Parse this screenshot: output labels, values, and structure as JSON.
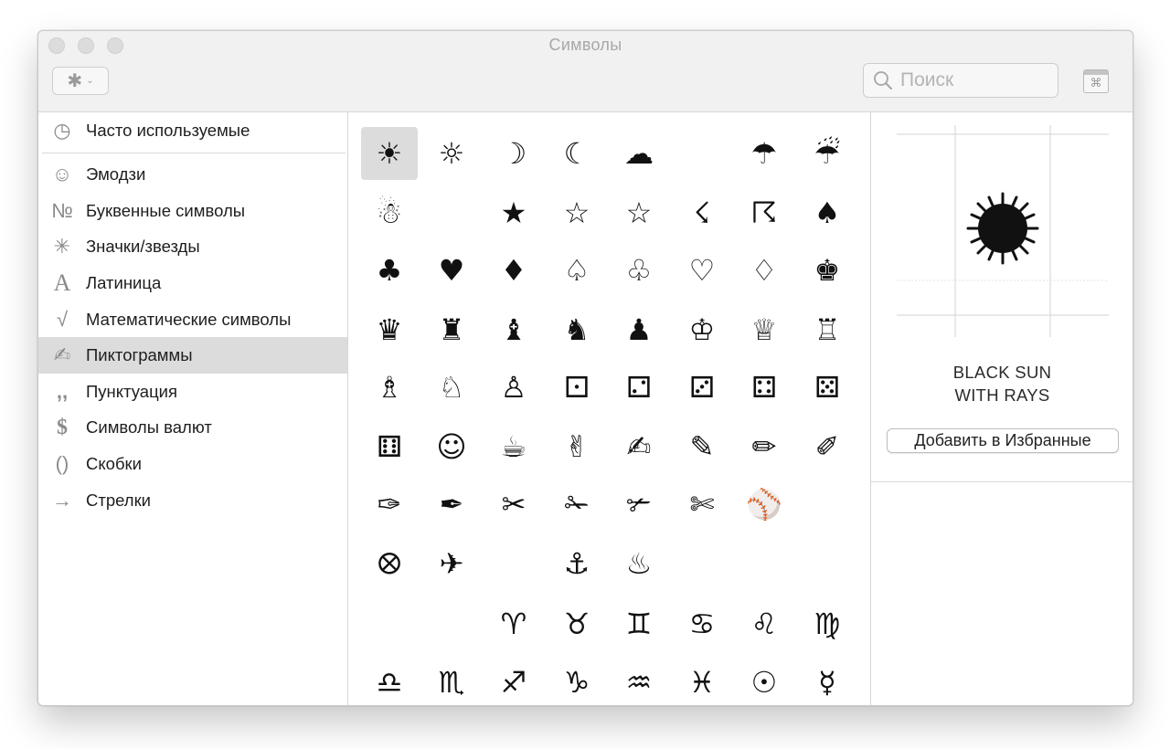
{
  "window": {
    "title": "Символы"
  },
  "toolbar": {
    "gear_icon": "✱",
    "chevron": "⌄",
    "search_placeholder": "Поиск",
    "viewer_icon": "⌘"
  },
  "sidebar": {
    "items": [
      {
        "icon": "◷",
        "label": "Часто используемые"
      },
      {
        "icon": "☺",
        "label": "Эмодзи"
      },
      {
        "icon": "№",
        "label": "Буквенные символы"
      },
      {
        "icon": "✳",
        "label": "Значки/звезды"
      },
      {
        "icon": "A",
        "label": "Латиница"
      },
      {
        "icon": "√",
        "label": "Математические символы"
      },
      {
        "icon": "✍",
        "label": "Пиктограммы"
      },
      {
        "icon": ",,",
        "label": "Пунктуация"
      },
      {
        "icon": "$",
        "label": "Символы валют"
      },
      {
        "icon": "()",
        "label": "Скобки"
      },
      {
        "icon": "→",
        "label": "Стрелки"
      }
    ],
    "selected": "Пиктограммы"
  },
  "grid": {
    "rows": [
      [
        "☀",
        "☼",
        "☽",
        "☾",
        "☁",
        "",
        "☂",
        "☔"
      ],
      [
        "☃",
        "",
        "★",
        "☆",
        "☆",
        "☇",
        "☈",
        "♠"
      ],
      [
        "♣",
        "♥",
        "♦",
        "♤",
        "♧",
        "♡",
        "♢",
        "♚"
      ],
      [
        "♛",
        "♜",
        "♝",
        "♞",
        "♟",
        "♔",
        "♕",
        "♖"
      ],
      [
        "♗",
        "♘",
        "♙",
        "⚀",
        "⚁",
        "⚂",
        "⚃",
        "⚄"
      ],
      [
        "⚅",
        "☺",
        "☕",
        "✌",
        "✍",
        "✎",
        "✏",
        "✐"
      ],
      [
        "✑",
        "✒",
        "✂",
        "✁",
        "✃",
        "✄",
        "⚾",
        ""
      ],
      [
        "⭙",
        "✈",
        "",
        "⚓",
        "♨",
        "",
        "",
        ""
      ],
      [
        "",
        "",
        "♈",
        "♉",
        "♊",
        "♋",
        "♌",
        "♍"
      ],
      [
        "♎",
        "♏",
        "♐",
        "♑",
        "♒",
        "♓",
        "☉",
        "☿"
      ]
    ],
    "selected_symbol": "☀"
  },
  "detail": {
    "name_line1": "BLACK SUN",
    "name_line2": "WITH RAYS",
    "add_favorites_button": "Добавить в Избранные"
  }
}
